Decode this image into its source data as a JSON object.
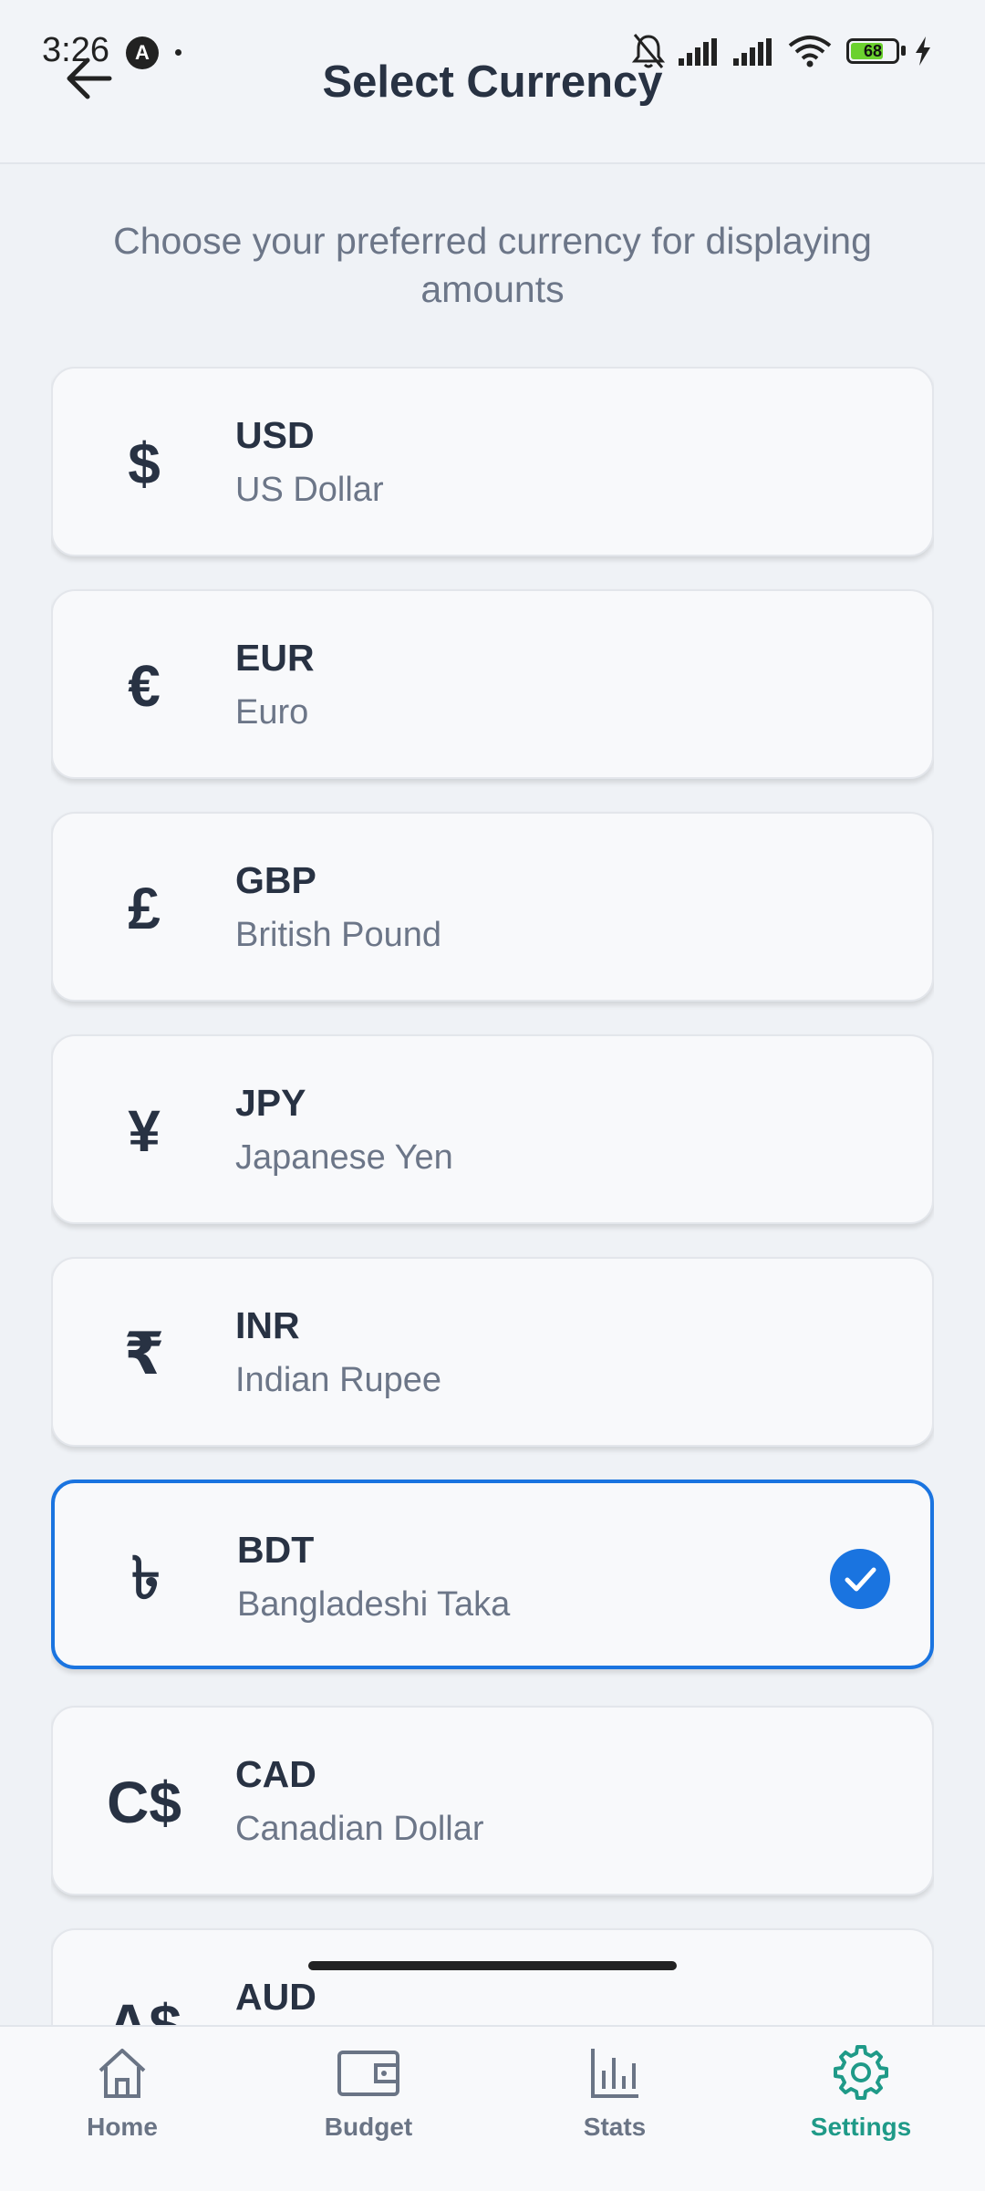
{
  "status_bar": {
    "time": "3:26",
    "app_badge": "A",
    "battery": "68"
  },
  "header": {
    "title": "Select Currency",
    "back_icon": "arrow-left-icon"
  },
  "subtitle": "Choose your preferred currency for displaying amounts",
  "currencies": [
    {
      "symbol": "$",
      "code": "USD",
      "name": "US Dollar",
      "selected": false
    },
    {
      "symbol": "€",
      "code": "EUR",
      "name": "Euro",
      "selected": false
    },
    {
      "symbol": "£",
      "code": "GBP",
      "name": "British Pound",
      "selected": false
    },
    {
      "symbol": "¥",
      "code": "JPY",
      "name": "Japanese Yen",
      "selected": false
    },
    {
      "symbol": "₹",
      "code": "INR",
      "name": "Indian Rupee",
      "selected": false
    },
    {
      "symbol": "৳",
      "code": "BDT",
      "name": "Bangladeshi Taka",
      "selected": true
    },
    {
      "symbol": "C$",
      "code": "CAD",
      "name": "Canadian Dollar",
      "selected": false
    },
    {
      "symbol": "A$",
      "code": "AUD",
      "name": "",
      "selected": false
    }
  ],
  "bottom_nav": [
    {
      "label": "Home",
      "icon": "home-icon",
      "active": false
    },
    {
      "label": "Budget",
      "icon": "wallet-icon",
      "active": false
    },
    {
      "label": "Stats",
      "icon": "bar-chart-icon",
      "active": false
    },
    {
      "label": "Settings",
      "icon": "gear-icon",
      "active": true
    }
  ],
  "colors": {
    "accent": "#1a74e0",
    "active_nav": "#1f9a88",
    "background": "#eff2f6"
  }
}
